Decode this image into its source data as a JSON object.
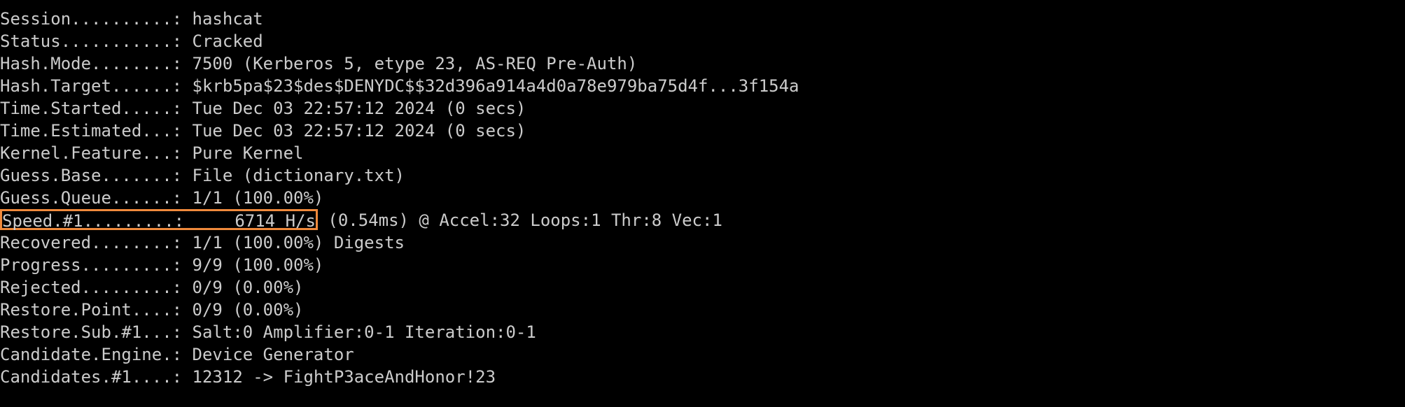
{
  "terminal": {
    "lines": [
      "Session..........: hashcat",
      "Status...........: Cracked",
      "Hash.Mode........: 7500 (Kerberos 5, etype 23, AS-REQ Pre-Auth)",
      "Hash.Target......: $krb5pa$23$des$DENYDC$$32d396a914a4d0a78e979ba75d4f...3f154a",
      "Time.Started.....: Tue Dec 03 22:57:12 2024 (0 secs)",
      "Time.Estimated...: Tue Dec 03 22:57:12 2024 (0 secs)",
      "Kernel.Feature...: Pure Kernel",
      "Guess.Base.......: File (dictionary.txt)",
      "Guess.Queue......: 1/1 (100.00%)",
      "Recovered........: 1/1 (100.00%) Digests",
      "Progress.........: 9/9 (100.00%)",
      "Rejected.........: 0/9 (0.00%)",
      "Restore.Point....: 0/9 (0.00%)",
      "Restore.Sub.#1...: Salt:0 Amplifier:0-1 Iteration:0-1",
      "Candidate.Engine.: Device Generator",
      "Candidates.#1....: 12312 -> FightP3aceAndHonor!23"
    ],
    "speed_highlight": "Speed.#1.........:     6714 H/s",
    "speed_rest": " (0.54ms) @ Accel:32 Loops:1 Thr:8 Vec:1"
  },
  "colors": {
    "background": "#000000",
    "text": "#cccccc",
    "highlight_border": "#f08a3c"
  }
}
